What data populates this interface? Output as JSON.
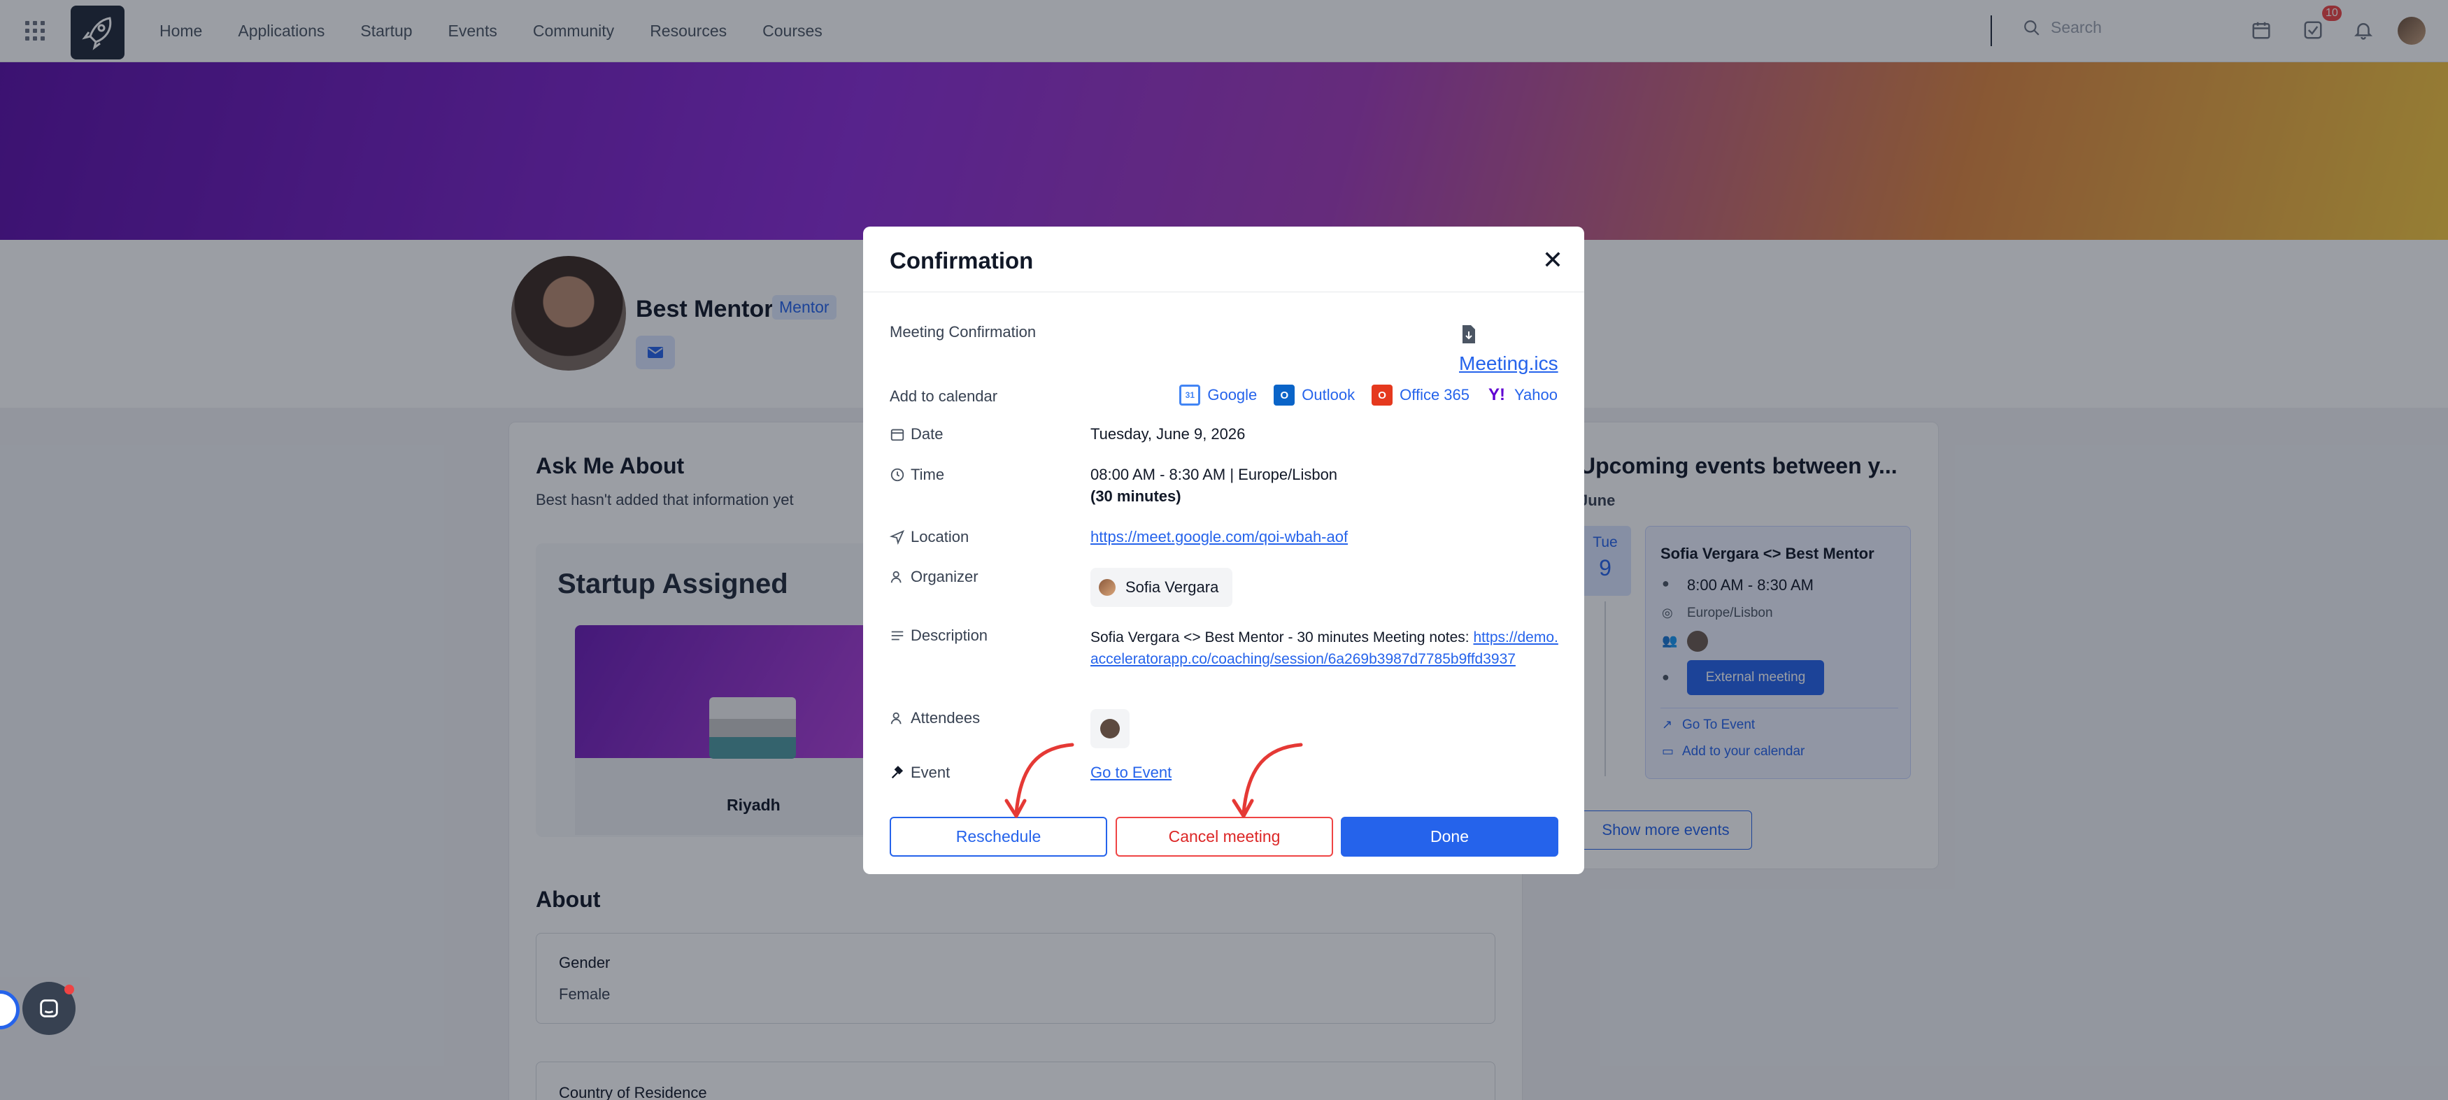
{
  "nav": {
    "items": [
      "Home",
      "Applications",
      "Startup",
      "Events",
      "Community",
      "Resources",
      "Courses"
    ],
    "search_placeholder": "Search",
    "tasks_badge": "10"
  },
  "profile": {
    "name": "Best Mentor",
    "role_tag": "Mentor"
  },
  "ask_me_about": {
    "title": "Ask Me About",
    "text": "Best hasn't added that information yet"
  },
  "startup": {
    "section_title": "Startup Assigned",
    "name": "Riyadh"
  },
  "about": {
    "title": "About",
    "gender_label": "Gender",
    "gender_value": "Female",
    "country_label": "Country of Residence"
  },
  "upcoming": {
    "title": "Upcoming events between y...",
    "month": "June",
    "day_of_week": "Tue",
    "day_number": "9",
    "event_title": "Sofia Vergara <> Best Mentor",
    "event_time": "8:00 AM - 8:30 AM",
    "event_timezone": "Europe/Lisbon",
    "external_button": "External meeting",
    "go_to_event": "Go To Event",
    "add_to_calendar": "Add to your calendar",
    "show_more": "Show more events"
  },
  "modal": {
    "title": "Confirmation",
    "meeting_confirmation_label": "Meeting Confirmation",
    "ics_file": "Meeting.ics",
    "add_to_calendar_label": "Add to calendar",
    "calendars": [
      "Google",
      "Outlook",
      "Office 365",
      "Yahoo"
    ],
    "date_label": "Date",
    "date_value": "Tuesday, June 9, 2026",
    "time_label": "Time",
    "time_value": "08:00 AM - 8:30 AM | Europe/Lisbon",
    "duration": "(30 minutes)",
    "location_label": "Location",
    "location_value": "https://meet.google.com/qoi-wbah-aof",
    "organizer_label": "Organizer",
    "organizer_value": "Sofia Vergara",
    "description_label": "Description",
    "description_text": "Sofia Vergara <> Best Mentor - 30 minutes Meeting notes: ",
    "description_link": "https://demo.acceleratorapp.co/coaching/session/6a269b3987d7785b9ffd3937",
    "attendees_label": "Attendees",
    "event_label": "Event",
    "event_link": "Go to Event",
    "buttons": {
      "reschedule": "Reschedule",
      "cancel": "Cancel meeting",
      "done": "Done"
    }
  },
  "colors": {
    "primary": "#2563eb",
    "danger": "#ef4444",
    "annotation_arrow": "#e53935"
  }
}
